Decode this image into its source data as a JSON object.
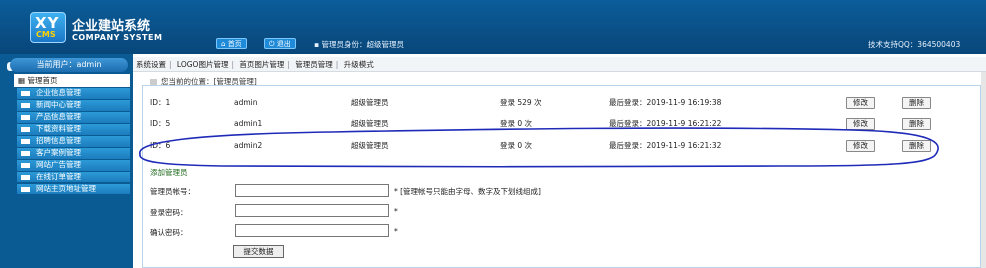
{
  "header": {
    "logo_xy": "XY",
    "logo_cms": "CMS",
    "title_cn": "企业建站系统",
    "title_en": "COMPANY SYSTEM",
    "home": "首页",
    "logout": "退出",
    "role_text": "管理员身份：超级管理员",
    "support": "技术支持QQ：364500403"
  },
  "sidebar": {
    "current_user": "当前用户：admin",
    "section": "管理首页",
    "items": [
      {
        "label": "企业信息管理"
      },
      {
        "label": "新闻中心管理"
      },
      {
        "label": "产品信息管理"
      },
      {
        "label": "下载资料管理"
      },
      {
        "label": "招聘信息管理"
      },
      {
        "label": "客户案例管理"
      },
      {
        "label": "网站广告管理"
      },
      {
        "label": "在线订单管理"
      },
      {
        "label": "网站主页地址管理"
      }
    ]
  },
  "toolbar": {
    "items": [
      "系统设置",
      "LOGO图片管理",
      "首页图片管理",
      "管理员管理",
      "升级模式"
    ]
  },
  "location": "您当前的位置：[管理员管理]",
  "admins": [
    {
      "id": "ID：1",
      "user": "admin",
      "role": "超级管理员",
      "count": "登录 529 次",
      "last": "最后登录：2019-11-9 16:19:38",
      "edit": "修改",
      "del": "删除"
    },
    {
      "id": "ID：5",
      "user": "admin1",
      "role": "超级管理员",
      "count": "登录 0 次",
      "last": "最后登录：2019-11-9 16:21:22",
      "edit": "修改",
      "del": "删除"
    },
    {
      "id": "ID：6",
      "user": "admin2",
      "role": "超级管理员",
      "count": "登录 0 次",
      "last": "最后登录：2019-11-9 16:21:32",
      "edit": "修改",
      "del": "删除"
    }
  ],
  "form": {
    "title": "添加管理员",
    "username_label": "管理员帐号：",
    "username_hint": "* [管理帐号只能由字母、数字及下划线组成]",
    "password_label": "登录密码：",
    "confirm_label": "确认密码：",
    "star": "*",
    "submit": "提交数据"
  }
}
